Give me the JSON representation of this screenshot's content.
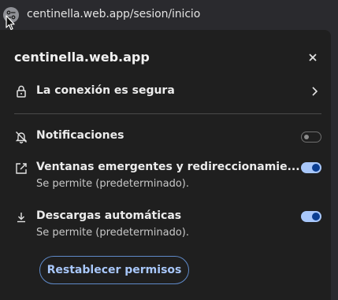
{
  "address_bar": {
    "url": "centinella.web.app/sesion/inicio",
    "site_info_icon": "tune-icon"
  },
  "panel": {
    "title": "centinella.web.app",
    "close_icon": "close-icon",
    "connection": {
      "label": "La conexión es segura",
      "icon": "lock-icon"
    },
    "permissions": [
      {
        "label": "Notificaciones",
        "sub": "",
        "icon": "notifications-off-icon",
        "enabled": false
      },
      {
        "label": "Ventanas emergentes y redireccionamie...",
        "sub": "Se permite (predeterminado).",
        "icon": "open-in-new-icon",
        "enabled": true
      },
      {
        "label": "Descargas automáticas",
        "sub": "Se permite (predeterminado).",
        "icon": "download-icon",
        "enabled": true
      }
    ],
    "reset_button": "Restablecer permisos"
  },
  "colors": {
    "accent": "#a8c7fa",
    "panel_bg": "#1f1f1f",
    "toolbar_bg": "#2a2a2e"
  }
}
